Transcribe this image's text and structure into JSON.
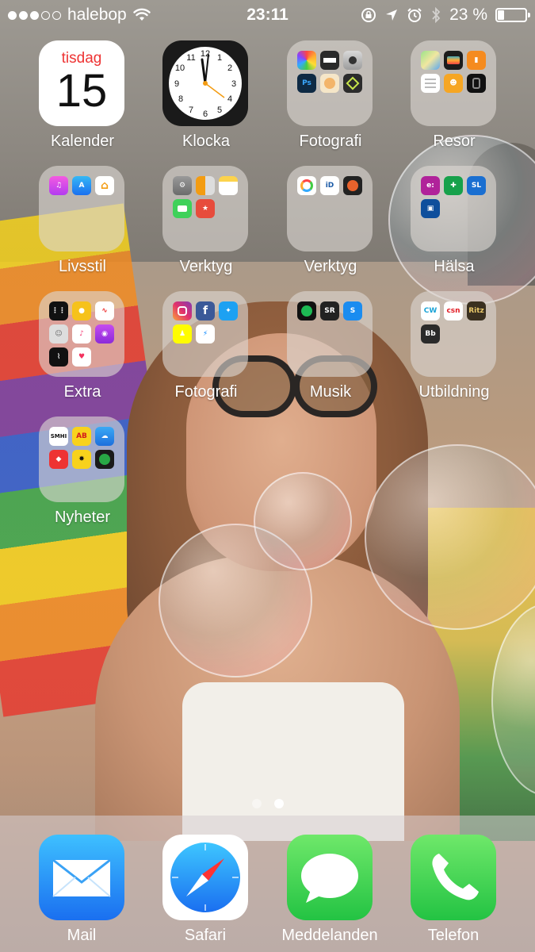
{
  "status_bar": {
    "carrier": "halebop",
    "time": "23:11",
    "battery_percent": "23 %",
    "battery_level": 0.23,
    "signal_dots": [
      1,
      1,
      1,
      0,
      0
    ]
  },
  "apps": {
    "kalender": {
      "label": "Kalender",
      "weekday": "tisdag",
      "date": "15"
    },
    "klocka": {
      "label": "Klocka"
    }
  },
  "folders": [
    {
      "label": "Fotografi",
      "apps": [
        "photos-icon",
        "clips-icon",
        "camera-icon",
        "photoshop-icon",
        "face-app-icon",
        "hyperlapse-icon"
      ]
    },
    {
      "label": "Resor",
      "apps": [
        "maps-icon",
        "wallet-icon",
        "ibooks-icon",
        "reminders-icon",
        "family-icon",
        "watch-icon"
      ]
    },
    {
      "label": "Livsstil",
      "apps": [
        "itunes-store-icon",
        "app-store-icon",
        "home-icon"
      ]
    },
    {
      "label": "Verktyg",
      "apps": [
        "settings-icon",
        "calculator-icon",
        "notes-icon",
        "facetime-icon",
        "todo-icon"
      ]
    },
    {
      "label": "Verktyg",
      "apps": [
        "photos-wheel-icon",
        "bankid-icon",
        "record-icon"
      ]
    },
    {
      "label": "Hälsa",
      "apps": [
        "e-app-icon",
        "pharmacy-icon",
        "sl-icon",
        "transit-icon"
      ]
    },
    {
      "label": "Extra",
      "apps": [
        "calc-dark-icon",
        "tips-icon",
        "voice-memo-icon",
        "contacts-icon",
        "music-icon",
        "podcasts-icon",
        "stocks-icon",
        "health-icon"
      ]
    },
    {
      "label": "Fotografi",
      "apps": [
        "instagram-icon",
        "facebook-icon",
        "twitter-icon",
        "snapchat-icon",
        "messenger-icon"
      ]
    },
    {
      "label": "Musik",
      "apps": [
        "spotify-icon",
        "sr-icon",
        "shazam-icon"
      ]
    },
    {
      "label": "Utbildning",
      "apps": [
        "cw-icon",
        "csn-icon",
        "ritz-icon",
        "bb-icon"
      ]
    },
    {
      "label": "Nyheter",
      "apps": [
        "smhi-icon",
        "aftonbladet-icon",
        "weather-icon",
        "news-icon",
        "expressen-icon",
        "radar-icon"
      ]
    }
  ],
  "mini_texts": {
    "smhi": "SMHI",
    "ab": "AB",
    "cw": "CW",
    "csn": "csn",
    "ritz": "Ritz",
    "bb": "Bb",
    "sr": "SR",
    "e": "e:"
  },
  "dock": [
    {
      "label": "Mail"
    },
    {
      "label": "Safari"
    },
    {
      "label": "Meddelanden"
    },
    {
      "label": "Telefon"
    }
  ],
  "page_indicator": {
    "count": 2,
    "active": 2
  },
  "colors": {
    "calendar_red": "#e33333",
    "mail_blue": "#1a8cf0",
    "messages_green": "#3fd15a",
    "phone_green": "#3fd15a"
  }
}
